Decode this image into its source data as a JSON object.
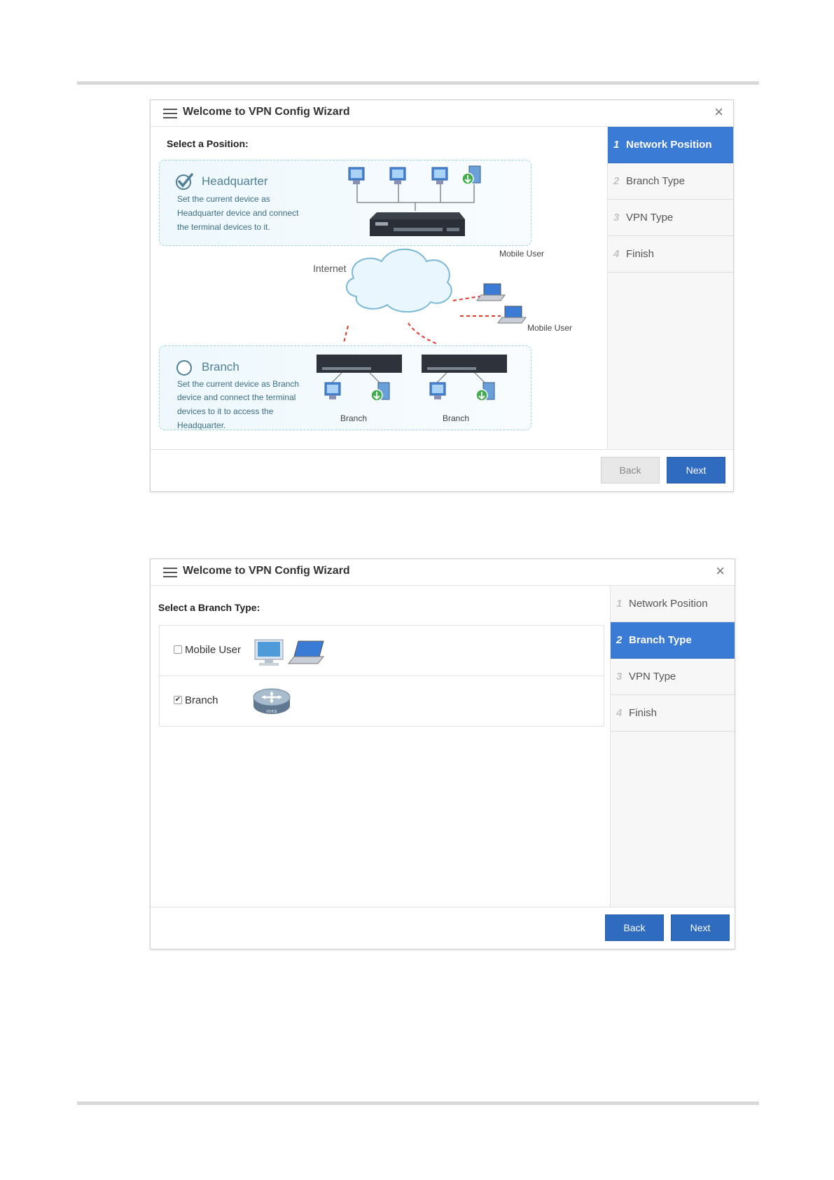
{
  "wizard1": {
    "title": "Welcome to VPN Config Wizard",
    "close_glyph": "×",
    "heading": "Select a Position:",
    "hq": {
      "name": "Headquarter",
      "desc1": "Set the current device as",
      "desc2": "Headquarter device and connect",
      "desc3": "the terminal devices to it.",
      "selected": true
    },
    "branch": {
      "name": "Branch",
      "desc1": "Set the current device as Branch",
      "desc2": "device and connect the terminal",
      "desc3": "devices to it to access the",
      "desc4": "Headquarter.",
      "selected": false
    },
    "diagram": {
      "internet": "Internet",
      "mobile_user_1": "Mobile User",
      "mobile_user_2": "Mobile User",
      "branch_label_1": "Branch",
      "branch_label_2": "Branch"
    },
    "steps": [
      {
        "num": "1",
        "label": "Network Position",
        "active": true
      },
      {
        "num": "2",
        "label": "Branch Type",
        "active": false
      },
      {
        "num": "3",
        "label": "VPN Type",
        "active": false
      },
      {
        "num": "4",
        "label": "Finish",
        "active": false
      }
    ],
    "back_label": "Back",
    "next_label": "Next"
  },
  "wizard2": {
    "title": "Welcome to VPN Config Wizard",
    "close_glyph": "×",
    "heading": "Select a Branch Type:",
    "options": [
      {
        "label": "Mobile User",
        "checked": false
      },
      {
        "label": "Branch",
        "checked": true
      }
    ],
    "router_caption": "VOICE",
    "steps": [
      {
        "num": "1",
        "label": "Network Position",
        "active": false
      },
      {
        "num": "2",
        "label": "Branch Type",
        "active": true
      },
      {
        "num": "3",
        "label": "VPN Type",
        "active": false
      },
      {
        "num": "4",
        "label": "Finish",
        "active": false
      }
    ],
    "back_label": "Back",
    "next_label": "Next"
  },
  "colors": {
    "accent": "#3a7bd5",
    "button_blue": "#2f6bbf",
    "dashed_link": "#e03a2e"
  }
}
